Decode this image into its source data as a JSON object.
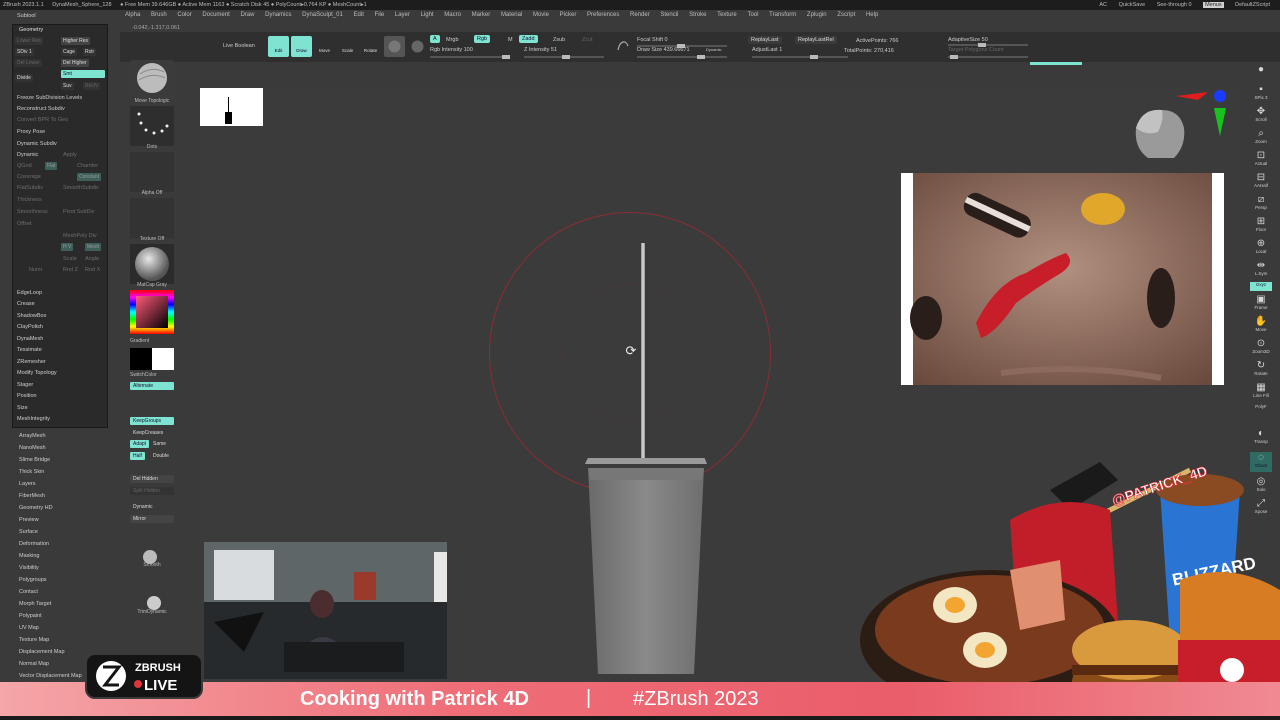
{
  "titlebar": {
    "items": [
      "ZBrush 2023.1.1",
      "DynaMesh_Sphere_128",
      "● Free Mem 39.646GB ● Active Mem 1163 ● Scratch Disk 45 ● PolyCount▸0.764 KP ● MeshCount▸1"
    ],
    "right": [
      "AC",
      "QuickSave",
      "See-through 0",
      "Menus",
      "DefaultZScript"
    ]
  },
  "menu": [
    "Alpha",
    "Brush",
    "Color",
    "Document",
    "Draw",
    "Dynamics",
    "DynaSculpt_01",
    "Edit",
    "File",
    "Layer",
    "Light",
    "Macro",
    "Marker",
    "Material",
    "Movie",
    "Picker",
    "Preferences",
    "Render",
    "Stencil",
    "Stroke",
    "Texture",
    "Tool",
    "Transform",
    "Zplugin",
    "Zscript",
    "Help"
  ],
  "coords": "-0.042,-1.317,0.061",
  "toolbar": {
    "live_boolean": "Live Boolean",
    "edit": "Edit",
    "draw": "Draw",
    "move": "Move",
    "scale": "Scale",
    "rotate": "Rotate",
    "a": "A",
    "mrgb": "Mrgb",
    "rgb": "Rgb",
    "m": "M",
    "zadd": "Zadd",
    "zsub": "Zsub",
    "zcut": "Zcut",
    "rgb_intensity": "Rgb Intensity 100",
    "z_intensity": "Z Intensity 51",
    "focal_shift": "Focal Shift 0",
    "draw_size": "Draw Size 439.66671",
    "dynamic": "Dynamic",
    "replay_last": "ReplayLast",
    "replay_last_rel": "ReplayLastRel",
    "adjust_last": "AdjustLast 1",
    "active_points": "ActivePoints: 766",
    "total_points": "TotalPoints: 270,416",
    "adaptive_size": "AdaptiveSize 50",
    "target_polygons": "Target Polygons Count"
  },
  "leftpanel": {
    "subtool": "Subtool",
    "geometry": "Geometry",
    "lower_res": "Lower Res",
    "higher_res": "Higher Res",
    "sdiv": "SDiv 1",
    "cage": "Cage",
    "rstr": "Rstr",
    "del_lower": "Del Lower",
    "del_higher": "Del Higher",
    "divide": "Divide",
    "smt": "Smt",
    "suv": "Suv",
    "reuv": "ReUV",
    "freeze": "Freeze SubDivision Levels",
    "reconstruct": "Reconstruct Subdiv",
    "convert_bpr": "Convert BPR To Geo",
    "proxy_pose": "Proxy Pose",
    "dynamic_subdiv": "Dynamic Subdiv",
    "dynamic": "Dynamic",
    "apply": "Apply",
    "qgrid": "QGrid",
    "coverage": "Coverage",
    "flat": "Flat",
    "chamfer": "Chamfer",
    "constant": "Constant",
    "flatsubdiv": "FlatSubdiv",
    "smoothsubdiv": "SmoothSubdiv",
    "thickness": "Thickness",
    "pivot_subdiv": "Pivot SubDiv",
    "smoothness": "Smoothness",
    "offset": "Offset",
    "meshpoly_div": "MeshPoly Div",
    "hv": "H V",
    "mesh": "Mesh",
    "angle": "Angle",
    "scale": "Scale",
    "rnd_z": "Rnd Z",
    "rnd_x": "Rnd X",
    "numi": "Numi",
    "edgeloop": "EdgeLoop",
    "crease": "Crease",
    "shadowbox": "ShadowBox",
    "claypolish": "ClayPolish",
    "dynamesh": "DynaMesh",
    "tessimate": "Tessimate",
    "zremesher": "ZRemesher",
    "modify_topology": "Modify Topology",
    "stager": "Stager",
    "position": "Position",
    "size": "Size",
    "meshintegrity": "MeshIntegrity"
  },
  "leftlist": [
    "ArrayMesh",
    "NanoMesh",
    "Slime Bridge",
    "Thick Skin",
    "Layers",
    "FiberMesh",
    "Geometry HD",
    "Preview",
    "Surface",
    "Deformation",
    "Masking",
    "Visibility",
    "Polygroups",
    "Contact",
    "Morph Target",
    "Polypaint",
    "UV Map",
    "Texture Map",
    "Displacement Map",
    "Normal Map",
    "Vector Displacement Map"
  ],
  "shelf": {
    "move_topologic": "Move Topologic",
    "dots": "Dots",
    "alpha_off": "Alpha Off",
    "texture_off": "Texture Off",
    "matcap_gray": "MatCap Gray",
    "gradient": "Gradient",
    "switch_color": "SwitchColor",
    "alternate": "Alternate",
    "keep_groups": "KeepGroups",
    "keep_creases": "KeepCreases",
    "adapt": "Adapt",
    "same": "Same",
    "half": "Half",
    "double": "Double",
    "del_hidden": "Del Hidden",
    "split_hidden": "Split Hidden",
    "dynamic": "Dynamic",
    "mirror": "Mirror",
    "smooth": "Smooth",
    "trim_dynamic": "TrimDynamic"
  },
  "rightpanel": [
    "SPix 3",
    "Scroll",
    "Zoom",
    "Actual",
    "AAHalf",
    "Persp",
    "Floor",
    "Local",
    "L.Sym",
    "Gxyz",
    "Frame",
    "Move",
    "Zoom3D",
    "Rotate",
    "Line Fill",
    "PolyF",
    "Transp",
    "Ghost",
    "Solo",
    "Xpose"
  ],
  "overlay": {
    "hashtag_handle": "@PATRICK_4D",
    "blizzard": "BLIZZARD",
    "zbrush_logo_top": "ZBRUSH",
    "zbrush_logo_live": "LIVE"
  },
  "banner": {
    "title": "Cooking with Patrick 4D",
    "separator": "|",
    "tag": "#ZBrush 2023"
  }
}
